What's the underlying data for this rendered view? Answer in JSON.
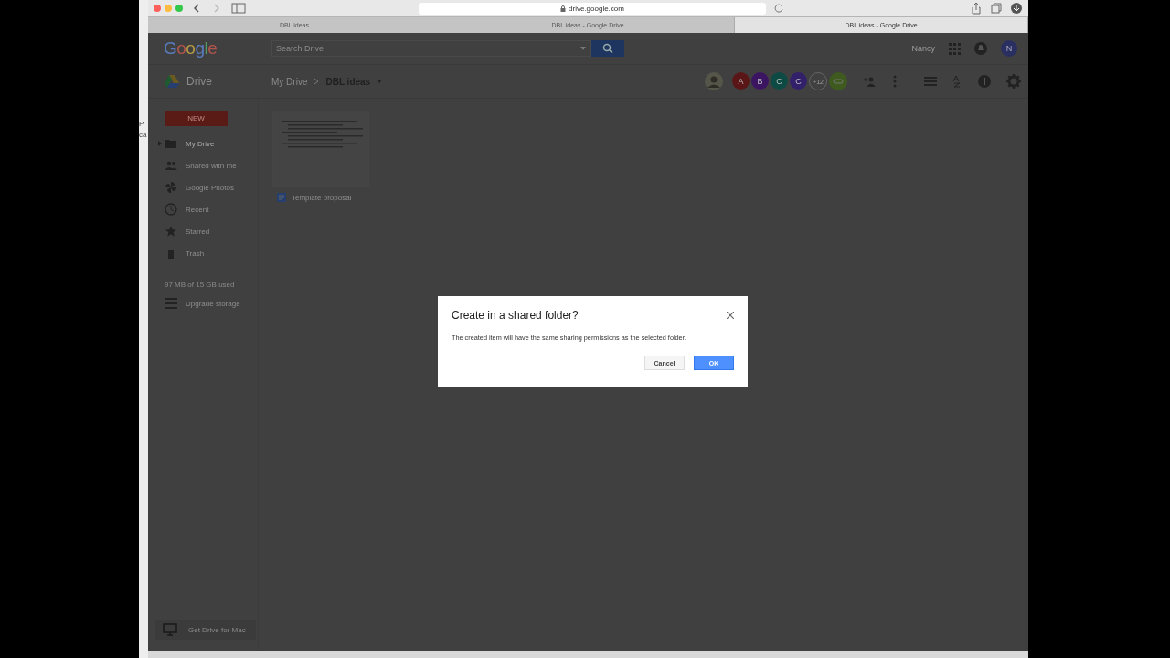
{
  "behind_window": {
    "texts": [
      "P",
      "ca"
    ]
  },
  "browser": {
    "url": "drive.google.com",
    "tabs": [
      {
        "label": "DBL ideas",
        "selected": false
      },
      {
        "label": "DBL ideas - Google Drive",
        "selected": false
      },
      {
        "label": "DBL ideas - Google Drive",
        "selected": true
      }
    ]
  },
  "header": {
    "logo": "Google",
    "search": {
      "placeholder": "Search Drive"
    },
    "user_name": "Nancy",
    "avatar_letter": "N"
  },
  "toolbar": {
    "app_name": "Drive",
    "breadcrumb": [
      {
        "label": "My Drive",
        "current": false
      },
      {
        "label": "DBL ideas",
        "current": true
      }
    ],
    "collaborators": [
      {
        "letter": "A",
        "color": "#5a1616"
      },
      {
        "letter": "B",
        "color": "#3b1462"
      },
      {
        "letter": "C",
        "color": "#0d4a44"
      },
      {
        "letter": "C",
        "color": "#33206a"
      }
    ],
    "more_count": "+12"
  },
  "sidebar": {
    "new_button": "NEW",
    "items": [
      {
        "label": "My Drive",
        "selected": true
      },
      {
        "label": "Shared with me",
        "selected": false
      },
      {
        "label": "Google Photos",
        "selected": false
      },
      {
        "label": "Recent",
        "selected": false
      },
      {
        "label": "Starred",
        "selected": false
      },
      {
        "label": "Trash",
        "selected": false
      }
    ],
    "storage": "97 MB of 15 GB used",
    "upgrade": "Upgrade storage",
    "get_drive": "Get Drive for Mac"
  },
  "files": [
    {
      "name": "Template proposal"
    }
  ],
  "dialog": {
    "title": "Create in a shared folder?",
    "message": "The created item will have the same sharing permissions as the selected folder.",
    "buttons": [
      "Cancel",
      "OK"
    ]
  }
}
